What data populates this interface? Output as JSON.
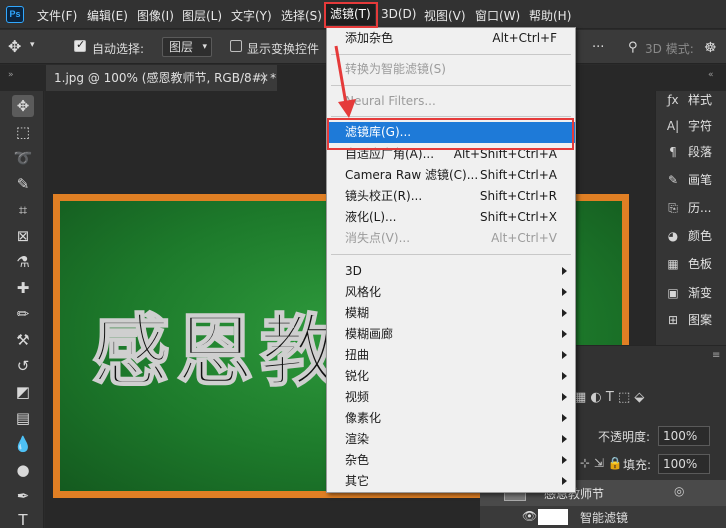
{
  "menubar": {
    "logo": "Ps",
    "items": [
      "文件(F)",
      "编辑(E)",
      "图像(I)",
      "图层(L)",
      "文字(Y)",
      "选择(S)",
      "滤镜(T)",
      "3D(D)",
      "视图(V)",
      "窗口(W)",
      "帮助(H)"
    ]
  },
  "options": {
    "auto_select": "自动选择:",
    "layer_select": "图层",
    "show_transform": "显示变换控件",
    "mode_3d": "3D 模式:"
  },
  "document": {
    "tab_title": "1.jpg @ 100% (感恩教师节, RGB/8#) *"
  },
  "canvas": {
    "board_text": "感恩教"
  },
  "right_panel": {
    "items": [
      {
        "icon": "fx-icon",
        "label": "样式"
      },
      {
        "icon": "character-icon",
        "label": "字符"
      },
      {
        "icon": "paragraph-icon",
        "label": "段落"
      },
      {
        "icon": "brush-icon",
        "label": "画笔"
      },
      {
        "icon": "history-icon",
        "label": "历..."
      },
      {
        "icon": "color-icon",
        "label": "颜色"
      },
      {
        "icon": "swatches-icon",
        "label": "色板"
      },
      {
        "icon": "gradient-icon",
        "label": "渐变"
      },
      {
        "icon": "pattern-icon",
        "label": "图案"
      }
    ]
  },
  "layers": {
    "opacity_label": "不透明度:",
    "opacity_value": "100%",
    "fill_label": "填充:",
    "fill_value": "100%",
    "layer_name": "感恩教师节",
    "smart_filter": "智能滤镜"
  },
  "filter_menu": {
    "items": [
      {
        "label": "添加杂色",
        "shortcut": "Alt+Ctrl+F",
        "disabled": false
      },
      {
        "label": "转换为智能滤镜(S)",
        "shortcut": "",
        "disabled": true
      },
      {
        "label": "Neural Filters...",
        "shortcut": "",
        "disabled": true
      },
      {
        "label": "滤镜库(G)...",
        "shortcut": "",
        "highlight": true
      },
      {
        "label": "自适应广角(A)...",
        "shortcut": "Alt+Shift+Ctrl+A"
      },
      {
        "label": "Camera Raw 滤镜(C)...",
        "shortcut": "Shift+Ctrl+A"
      },
      {
        "label": "镜头校正(R)...",
        "shortcut": "Shift+Ctrl+R"
      },
      {
        "label": "液化(L)...",
        "shortcut": "Shift+Ctrl+X"
      },
      {
        "label": "消失点(V)...",
        "shortcut": "Alt+Ctrl+V",
        "disabled": true
      },
      {
        "label": "3D",
        "submenu": true
      },
      {
        "label": "风格化",
        "submenu": true
      },
      {
        "label": "模糊",
        "submenu": true
      },
      {
        "label": "模糊画廊",
        "submenu": true
      },
      {
        "label": "扭曲",
        "submenu": true
      },
      {
        "label": "锐化",
        "submenu": true
      },
      {
        "label": "视频",
        "submenu": true
      },
      {
        "label": "像素化",
        "submenu": true
      },
      {
        "label": "渲染",
        "submenu": true
      },
      {
        "label": "杂色",
        "submenu": true
      },
      {
        "label": "其它",
        "submenu": true
      }
    ]
  },
  "colors": {
    "highlight": "#1e7ad8",
    "annotation_red": "#e53a3a",
    "board_orange": "#e07f24",
    "board_green": "#1d7a2b"
  }
}
